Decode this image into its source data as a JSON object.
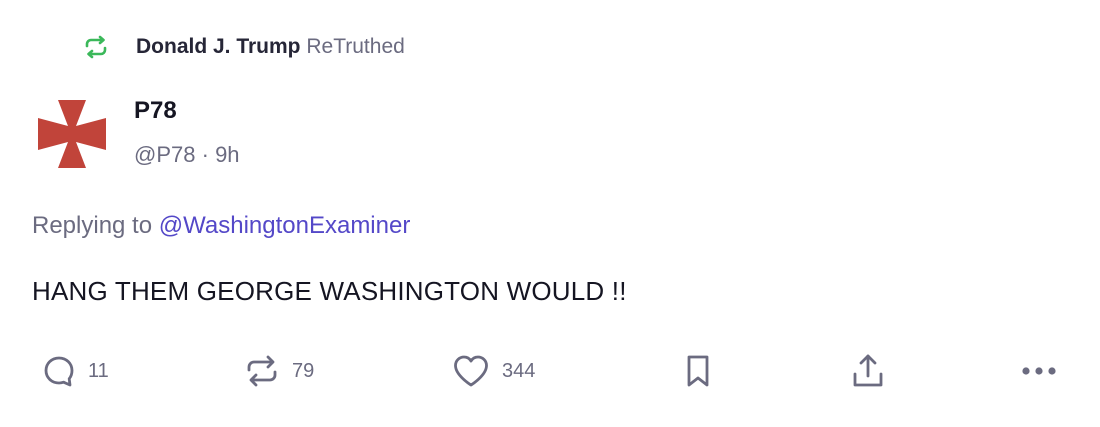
{
  "retruth": {
    "icon": "retruth-icon",
    "icon_color": "#3bb85a",
    "user": "Donald J. Trump",
    "label": "ReTruthed"
  },
  "post": {
    "avatar": "red-cross-pattee-avatar",
    "avatar_color": "#c1443a",
    "display_name": "P78",
    "handle": "@P78",
    "separator": "·",
    "time": "9h",
    "replying_prefix": "Replying to",
    "replying_to": "@WashingtonExaminer",
    "text": "HANG THEM GEORGE WASHINGTON WOULD !!"
  },
  "actions": {
    "reply_count": "11",
    "retruth_count": "79",
    "like_count": "344"
  },
  "colors": {
    "text_primary": "#151522",
    "text_secondary": "#6b6b80",
    "mention": "#5448c8",
    "icon": "#6b6b80"
  }
}
